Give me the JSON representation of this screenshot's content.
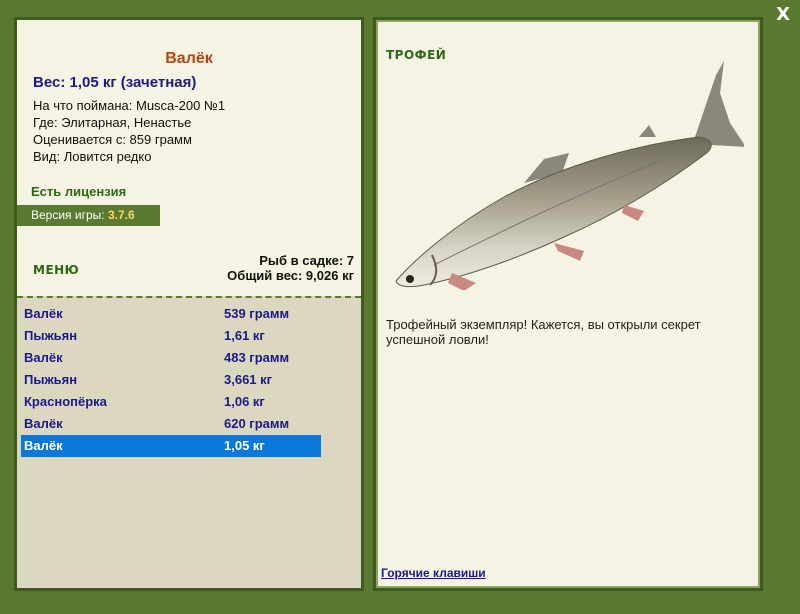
{
  "close": {
    "label": "X"
  },
  "fish": {
    "title": "Валёк",
    "weight_line": "Вес: 1,05 кг (зачетная)",
    "caught_on": "На что поймана: Musca-200 №1",
    "where": "Где: Элитарная, Ненастье",
    "valued_from": "Оценивается с: 859 грамм",
    "kind": "Вид: Ловится редко"
  },
  "license": "Есть лицензия",
  "version": {
    "label": "Версия игры:",
    "value": "3.7.6"
  },
  "menu": {
    "label": "МЕНЮ"
  },
  "stats": {
    "count": "Рыб в садке: 7",
    "total": "Общий вес: 9,026 кг"
  },
  "catch_list": [
    {
      "name": "Валёк",
      "weight": "539 грамм"
    },
    {
      "name": "Пыжьян",
      "weight": "1,61 кг"
    },
    {
      "name": "Валёк",
      "weight": "483 грамм"
    },
    {
      "name": "Пыжьян",
      "weight": "3,661 кг"
    },
    {
      "name": "Краснопёрка",
      "weight": "1,06 кг"
    },
    {
      "name": "Валёк",
      "weight": "620 грамм"
    },
    {
      "name": "Валёк",
      "weight": "1,05 кг"
    }
  ],
  "selected_index": 6,
  "trophy": {
    "label": "ТРОФЕЙ",
    "text": "Трофейный экземпляр! Кажется, вы открыли секрет успешной ловли!"
  },
  "hotkeys": "Горячие клавиши",
  "colors": {
    "frame": "#5a7a32",
    "selected": "#0a78d8",
    "title": "#b5460e",
    "link": "#1a1a8a"
  }
}
